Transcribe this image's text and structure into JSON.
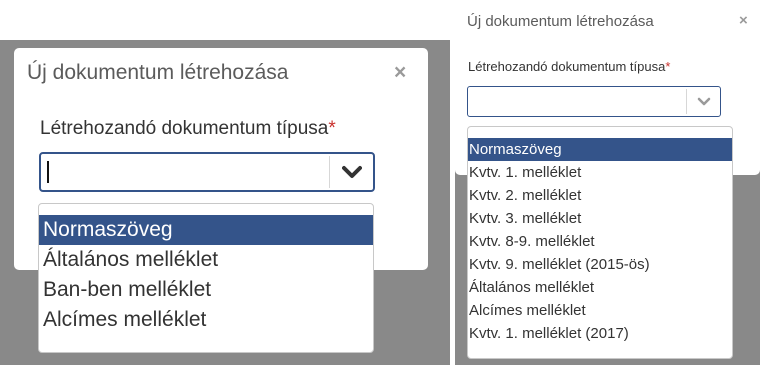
{
  "left_panel": {
    "title": "Új dokumentum létrehozása",
    "close": "×",
    "label": "Létrehozandó dokumentum típusa",
    "required": "*",
    "input_value": "",
    "options": [
      "Normaszöveg",
      "Általános melléklet",
      "Ban-ben melléklet",
      "Alcímes melléklet"
    ],
    "selected_index": 0
  },
  "right_panel": {
    "title": "Új dokumentum létrehozása",
    "close": "×",
    "label": "Létrehozandó dokumentum típusa",
    "required": "*",
    "input_value": "",
    "options": [
      "Normaszöveg",
      "Kvtv. 1. melléklet",
      "Kvtv. 2. melléklet",
      "Kvtv. 3. melléklet",
      "Kvtv. 8-9. melléklet",
      "Kvtv. 9. melléklet (2015-ös)",
      "Általános melléklet",
      "Alcímes melléklet",
      "Kvtv. 1. melléklet (2017)"
    ],
    "selected_index": 0
  },
  "colors": {
    "backdrop": "#898989",
    "highlight": "#34548a",
    "focus_border": "#34548a",
    "required_mark": "#c9302c"
  },
  "icons": {
    "dropdown_toggle": "chevron-down-icon",
    "close": "close-icon"
  }
}
